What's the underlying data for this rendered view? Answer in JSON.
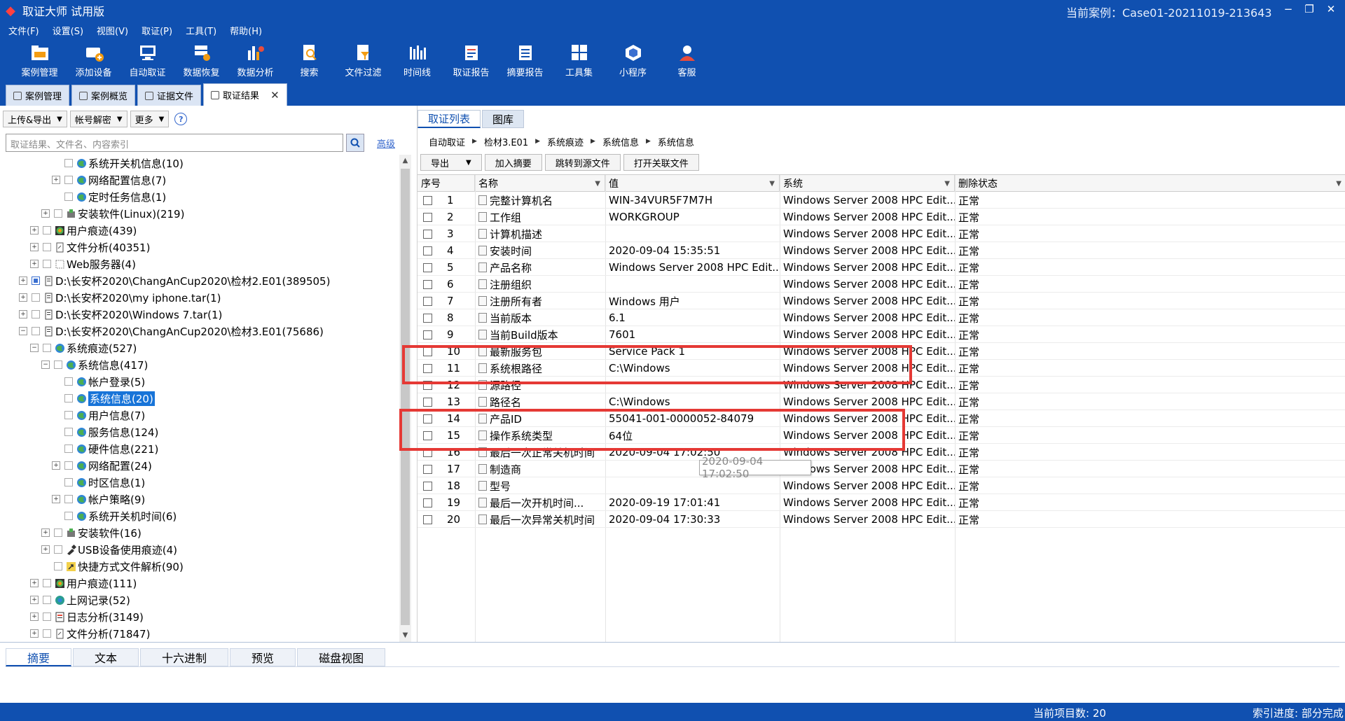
{
  "app": {
    "title": "取证大师 试用版",
    "current_case": "当前案例：Case01-20211019-213643"
  },
  "menu": [
    "文件(F)",
    "设置(S)",
    "视图(V)",
    "取证(P)",
    "工具(T)",
    "帮助(H)"
  ],
  "toolbar": [
    {
      "label": "案例管理",
      "icon": "folder-icon"
    },
    {
      "label": "添加设备",
      "icon": "add-device-icon"
    },
    {
      "label": "自动取证",
      "icon": "auto-forensics-icon"
    },
    {
      "label": "数据恢复",
      "icon": "data-recovery-icon"
    },
    {
      "label": "数据分析",
      "icon": "analysis-icon"
    },
    {
      "label": "搜索",
      "icon": "search-doc-icon"
    },
    {
      "label": "文件过滤",
      "icon": "filter-icon"
    },
    {
      "label": "时间线",
      "icon": "timeline-icon"
    },
    {
      "label": "取证报告",
      "icon": "report-icon"
    },
    {
      "label": "摘要报告",
      "icon": "summary-report-icon"
    },
    {
      "label": "工具集",
      "icon": "toolset-icon"
    },
    {
      "label": "小程序",
      "icon": "miniprogram-icon"
    },
    {
      "label": "客服",
      "icon": "support-icon"
    }
  ],
  "doc_tabs": [
    {
      "label": "案例管理",
      "active": false
    },
    {
      "label": "案例概览",
      "active": false
    },
    {
      "label": "证据文件",
      "active": false
    },
    {
      "label": "取证结果",
      "active": true
    }
  ],
  "left": {
    "tools": [
      "上传&导出",
      "帐号解密",
      "更多"
    ],
    "search_placeholder": "取证结果、文件名、内容索引",
    "advanced": "高级",
    "tree": [
      {
        "label": "系统开关机信息(10)",
        "depth": 5,
        "expander": "",
        "icon": "globe"
      },
      {
        "label": "网络配置信息(7)",
        "depth": 5,
        "expander": "+",
        "icon": "globe"
      },
      {
        "label": "定时任务信息(1)",
        "depth": 5,
        "expander": "",
        "icon": "globe"
      },
      {
        "label": "安装软件(Linux)(219)",
        "depth": 4,
        "expander": "+",
        "icon": "install"
      },
      {
        "label": "用户痕迹(439)",
        "depth": 3,
        "expander": "+",
        "icon": "user"
      },
      {
        "label": "文件分析(40351)",
        "depth": 3,
        "expander": "+",
        "icon": "file"
      },
      {
        "label": "Web服务器(4)",
        "depth": 3,
        "expander": "+",
        "icon": "web"
      },
      {
        "label": "D:\\长安杯2020\\ChangAnCup2020\\检材2.E01(389505)",
        "depth": 2,
        "expander": "+",
        "icon": "disk",
        "partial": true
      },
      {
        "label": "D:\\长安杯2020\\my iphone.tar(1)",
        "depth": 2,
        "expander": "+",
        "icon": "disk"
      },
      {
        "label": "D:\\长安杯2020\\Windows 7.tar(1)",
        "depth": 2,
        "expander": "+",
        "icon": "disk"
      },
      {
        "label": "D:\\长安杯2020\\ChangAnCup2020\\检材3.E01(75686)",
        "depth": 2,
        "expander": "−",
        "icon": "disk"
      },
      {
        "label": "系统痕迹(527)",
        "depth": 3,
        "expander": "−",
        "icon": "globe"
      },
      {
        "label": "系统信息(417)",
        "depth": 4,
        "expander": "−",
        "icon": "globe"
      },
      {
        "label": "帐户登录(5)",
        "depth": 5,
        "expander": "",
        "icon": "globe"
      },
      {
        "label": "系统信息(20)",
        "depth": 5,
        "expander": "",
        "icon": "globe",
        "selected": true
      },
      {
        "label": "用户信息(7)",
        "depth": 5,
        "expander": "",
        "icon": "globe"
      },
      {
        "label": "服务信息(124)",
        "depth": 5,
        "expander": "",
        "icon": "globe"
      },
      {
        "label": "硬件信息(221)",
        "depth": 5,
        "expander": "",
        "icon": "globe"
      },
      {
        "label": "网络配置(24)",
        "depth": 5,
        "expander": "+",
        "icon": "globe"
      },
      {
        "label": "时区信息(1)",
        "depth": 5,
        "expander": "",
        "icon": "globe"
      },
      {
        "label": "帐户策略(9)",
        "depth": 5,
        "expander": "+",
        "icon": "globe"
      },
      {
        "label": "系统开关机时间(6)",
        "depth": 5,
        "expander": "",
        "icon": "globe"
      },
      {
        "label": "安装软件(16)",
        "depth": 4,
        "expander": "+",
        "icon": "install"
      },
      {
        "label": "USB设备使用痕迹(4)",
        "depth": 4,
        "expander": "+",
        "icon": "usb"
      },
      {
        "label": "快捷方式文件解析(90)",
        "depth": 4,
        "expander": "",
        "icon": "shortcut"
      },
      {
        "label": "用户痕迹(111)",
        "depth": 3,
        "expander": "+",
        "icon": "user"
      },
      {
        "label": "上网记录(52)",
        "depth": 3,
        "expander": "+",
        "icon": "web2"
      },
      {
        "label": "日志分析(3149)",
        "depth": 3,
        "expander": "+",
        "icon": "log"
      },
      {
        "label": "文件分析(71847)",
        "depth": 3,
        "expander": "+",
        "icon": "file"
      }
    ]
  },
  "right": {
    "tabs": [
      {
        "label": "取证列表",
        "active": true
      },
      {
        "label": "图库",
        "active": false
      }
    ],
    "breadcrumb": [
      "自动取证",
      "检材3.E01",
      "系统痕迹",
      "系统信息",
      "系统信息"
    ],
    "buttons": {
      "export": "导出",
      "add_summary": "加入摘要",
      "jump_source": "跳转到源文件",
      "open_related": "打开关联文件"
    },
    "columns": [
      "序号",
      "名称",
      "值",
      "系统",
      "删除状态"
    ],
    "rows": [
      {
        "n": "1",
        "name": "完整计算机名",
        "value": "WIN-34VUR5F7M7H",
        "sys": "Windows Server 2008 HPC Edit...",
        "state": "正常"
      },
      {
        "n": "2",
        "name": "工作组",
        "value": "WORKGROUP",
        "sys": "Windows Server 2008 HPC Edit...",
        "state": "正常"
      },
      {
        "n": "3",
        "name": "计算机描述",
        "value": "",
        "sys": "Windows Server 2008 HPC Edit...",
        "state": "正常"
      },
      {
        "n": "4",
        "name": "安装时间",
        "value": "2020-09-04 15:35:51",
        "sys": "Windows Server 2008 HPC Edit...",
        "state": "正常"
      },
      {
        "n": "5",
        "name": "产品名称",
        "value": "Windows Server 2008 HPC Edit...",
        "sys": "Windows Server 2008 HPC Edit...",
        "state": "正常"
      },
      {
        "n": "6",
        "name": "注册组织",
        "value": "",
        "sys": "Windows Server 2008 HPC Edit...",
        "state": "正常"
      },
      {
        "n": "7",
        "name": "注册所有者",
        "value": "Windows 用户",
        "sys": "Windows Server 2008 HPC Edit...",
        "state": "正常"
      },
      {
        "n": "8",
        "name": "当前版本",
        "value": "6.1",
        "sys": "Windows Server 2008 HPC Edit...",
        "state": "正常"
      },
      {
        "n": "9",
        "name": "当前Build版本",
        "value": "7601",
        "sys": "Windows Server 2008 HPC Edit...",
        "state": "正常"
      },
      {
        "n": "10",
        "name": "最新服务包",
        "value": "Service Pack 1",
        "sys": "Windows Server 2008 HPC Edit...",
        "state": "正常"
      },
      {
        "n": "11",
        "name": "系统根路径",
        "value": "C:\\Windows",
        "sys": "Windows Server 2008 HPC Edit...",
        "state": "正常"
      },
      {
        "n": "12",
        "name": "源路径",
        "value": "",
        "sys": "Windows Server 2008 HPC Edit...",
        "state": "正常"
      },
      {
        "n": "13",
        "name": "路径名",
        "value": "C:\\Windows",
        "sys": "Windows Server 2008 HPC Edit...",
        "state": "正常"
      },
      {
        "n": "14",
        "name": "产品ID",
        "value": "55041-001-0000052-84079",
        "sys": "Windows Server 2008 HPC Edit...",
        "state": "正常"
      },
      {
        "n": "15",
        "name": "操作系统类型",
        "value": "64位",
        "sys": "Windows Server 2008 HPC Edit...",
        "state": "正常"
      },
      {
        "n": "16",
        "name": "最后一次正常关机时间",
        "value": "2020-09-04 17:02:50",
        "sys": "Windows Server 2008 HPC Edit...",
        "state": "正常"
      },
      {
        "n": "17",
        "name": "制造商",
        "value": "",
        "sys": "Windows Server 2008 HPC Edit...",
        "state": "正常"
      },
      {
        "n": "18",
        "name": "型号",
        "value": "",
        "sys": "Windows Server 2008 HPC Edit...",
        "state": "正常"
      },
      {
        "n": "19",
        "name": "最后一次开机时间...",
        "value": "2020-09-19 17:01:41",
        "sys": "Windows Server 2008 HPC Edit...",
        "state": "正常"
      },
      {
        "n": "20",
        "name": "最后一次异常关机时间",
        "value": "2020-09-04 17:30:33",
        "sys": "Windows Server 2008 HPC Edit...",
        "state": "正常"
      }
    ],
    "tooltip": "2020-09-04 17:02:50",
    "highlight_color": "#e53935"
  },
  "bottom": {
    "tabs": [
      {
        "label": "摘要",
        "active": true
      },
      {
        "label": "文本"
      },
      {
        "label": "十六进制"
      },
      {
        "label": "预览"
      },
      {
        "label": "磁盘视图"
      }
    ]
  },
  "status": {
    "count": "当前项目数: 20",
    "index": "索引进度: 部分完成"
  }
}
